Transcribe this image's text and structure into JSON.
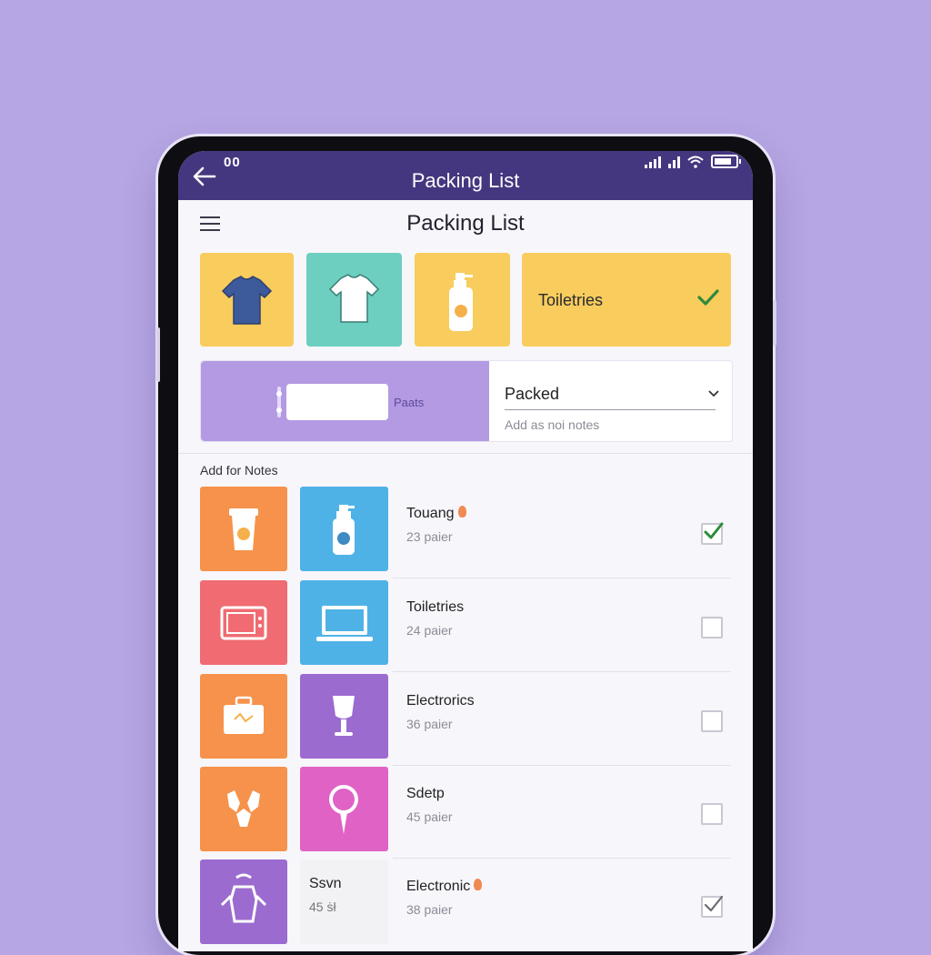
{
  "status": {
    "time": "00"
  },
  "topbar": {
    "title": "Packing List"
  },
  "header": {
    "title": "Packing List"
  },
  "categories": [
    {
      "icon": "shirt-icon",
      "color": "#f8cc5d"
    },
    {
      "icon": "tshirt-icon",
      "color": "#6ccfc0"
    },
    {
      "icon": "lotion-bottle-icon",
      "color": "#f8cc5d"
    },
    {
      "label": "Toiletries",
      "color": "#f8cc5d",
      "checked": true
    }
  ],
  "status_panel": {
    "field_label": "Paats",
    "select_value": "Packed",
    "notes_placeholder": "Add as noi notes"
  },
  "section_label": "Add for Notes",
  "items": [
    {
      "title": "Touang",
      "subtitle": "23 paier",
      "checked": true,
      "icon1": "cup-icon",
      "icon1_color": "#f6924b",
      "icon2": "lotion-bottle-icon",
      "icon2_color": "#4fb2e6",
      "dot": true
    },
    {
      "title": "Toiletries",
      "subtitle": "24 paier",
      "checked": false,
      "icon1": "tv-icon",
      "icon1_color": "#f06b72",
      "icon2": "laptop-icon",
      "icon2_color": "#4fb2e6",
      "dot": false
    },
    {
      "title": "Electrorics",
      "subtitle": "36 paier",
      "checked": false,
      "icon1": "suitcase-icon",
      "icon1_color": "#f6924b",
      "icon2": "goblet-icon",
      "icon2_color": "#9b6bd0",
      "dot": false
    },
    {
      "title": "Sdetp",
      "subtitle": "45 paier",
      "checked": false,
      "icon1": "gloves-icon",
      "icon1_color": "#f6924b",
      "icon2": "pin-icon",
      "icon2_color": "#e062c4",
      "dot": false
    },
    {
      "title": "Electronic",
      "subtitle": "38 paier",
      "checked": true,
      "icon1": "apron-icon",
      "icon1_color": "#9b6bd0",
      "card_title": "Ssvn",
      "card_sub": "45 ṡł",
      "dot": true
    }
  ],
  "colors": {
    "topbar": "#45377f",
    "background": "#b6a6e3",
    "check": "#2e8b3a"
  }
}
